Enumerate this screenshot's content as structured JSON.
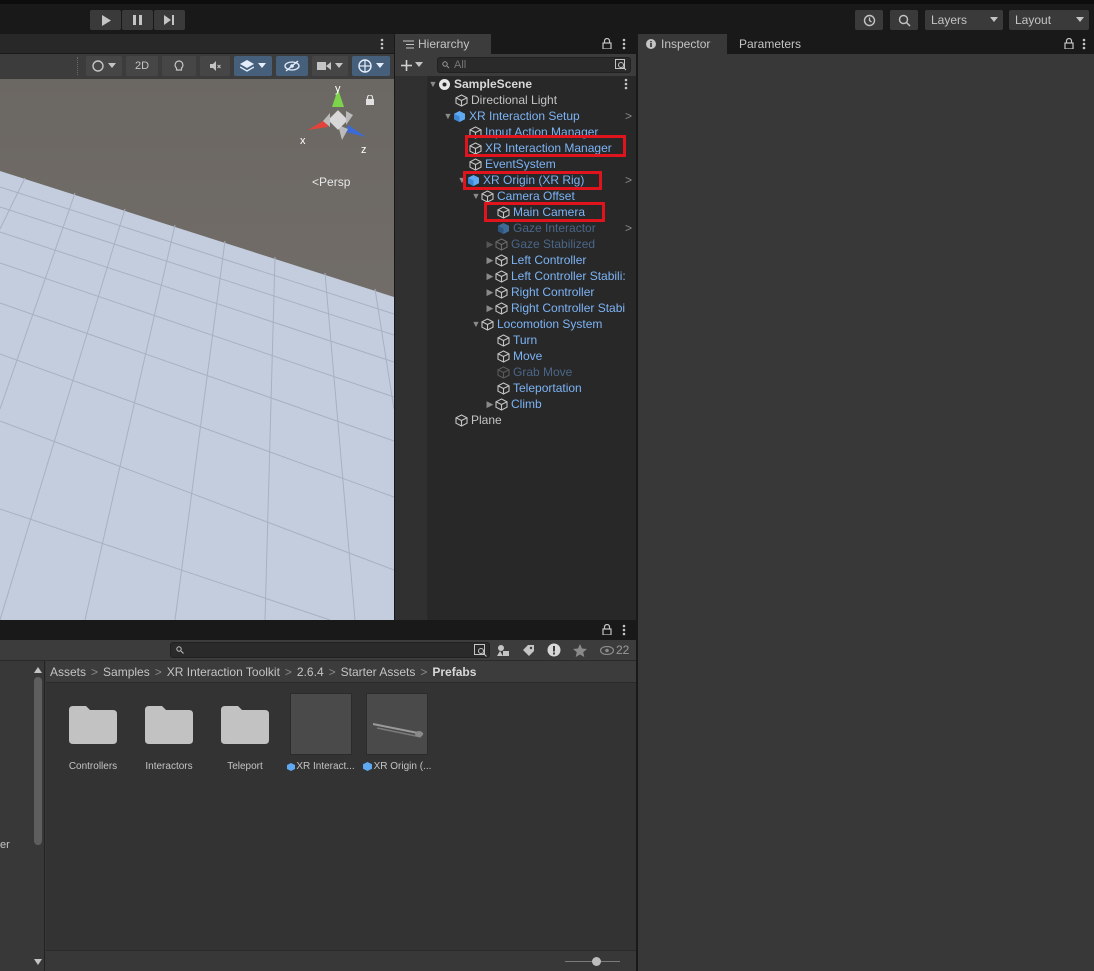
{
  "toolbar": {
    "layers_label": "Layers",
    "layout_label": "Layout"
  },
  "scene": {
    "btn_2d": "2D",
    "gizmo_y": "y",
    "gizmo_x": "x",
    "gizmo_z": "z",
    "persp_label": "Persp"
  },
  "hierarchy": {
    "tab_label": "Hierarchy",
    "search_placeholder": "All",
    "rows": [
      {
        "label": "SampleScene"
      },
      {
        "label": "Directional Light"
      },
      {
        "label": "XR Interaction Setup"
      },
      {
        "label": "Input Action Manager"
      },
      {
        "label": "XR Interaction Manager"
      },
      {
        "label": "EventSystem"
      },
      {
        "label": "XR Origin (XR Rig)"
      },
      {
        "label": "Camera Offset"
      },
      {
        "label": "Main Camera"
      },
      {
        "label": "Gaze Interactor"
      },
      {
        "label": "Gaze Stabilized"
      },
      {
        "label": "Left Controller"
      },
      {
        "label": "Left Controller Stabili:"
      },
      {
        "label": "Right Controller"
      },
      {
        "label": "Right Controller Stabi"
      },
      {
        "label": "Locomotion System"
      },
      {
        "label": "Turn"
      },
      {
        "label": "Move"
      },
      {
        "label": "Grab Move"
      },
      {
        "label": "Teleportation"
      },
      {
        "label": "Climb"
      },
      {
        "label": "Plane"
      }
    ]
  },
  "inspector": {
    "tab_inspector": "Inspector",
    "tab_parameters": "Parameters"
  },
  "project": {
    "visible_count": "22",
    "breadcrumb": [
      "Assets",
      "Samples",
      "XR Interaction Toolkit",
      "2.6.4",
      "Starter Assets",
      "Prefabs"
    ],
    "left_partial_text": "er",
    "assets": [
      {
        "label": "Controllers",
        "kind": "folder"
      },
      {
        "label": "Interactors",
        "kind": "folder"
      },
      {
        "label": "Teleport",
        "kind": "folder"
      },
      {
        "label": "XR Interact...",
        "kind": "prefab"
      },
      {
        "label": "XR Origin (...",
        "kind": "prefab"
      }
    ]
  },
  "colors": {
    "accent_blue": "#7cb3f5",
    "highlight_red": "#e0141c",
    "panel_bg": "#383838"
  }
}
